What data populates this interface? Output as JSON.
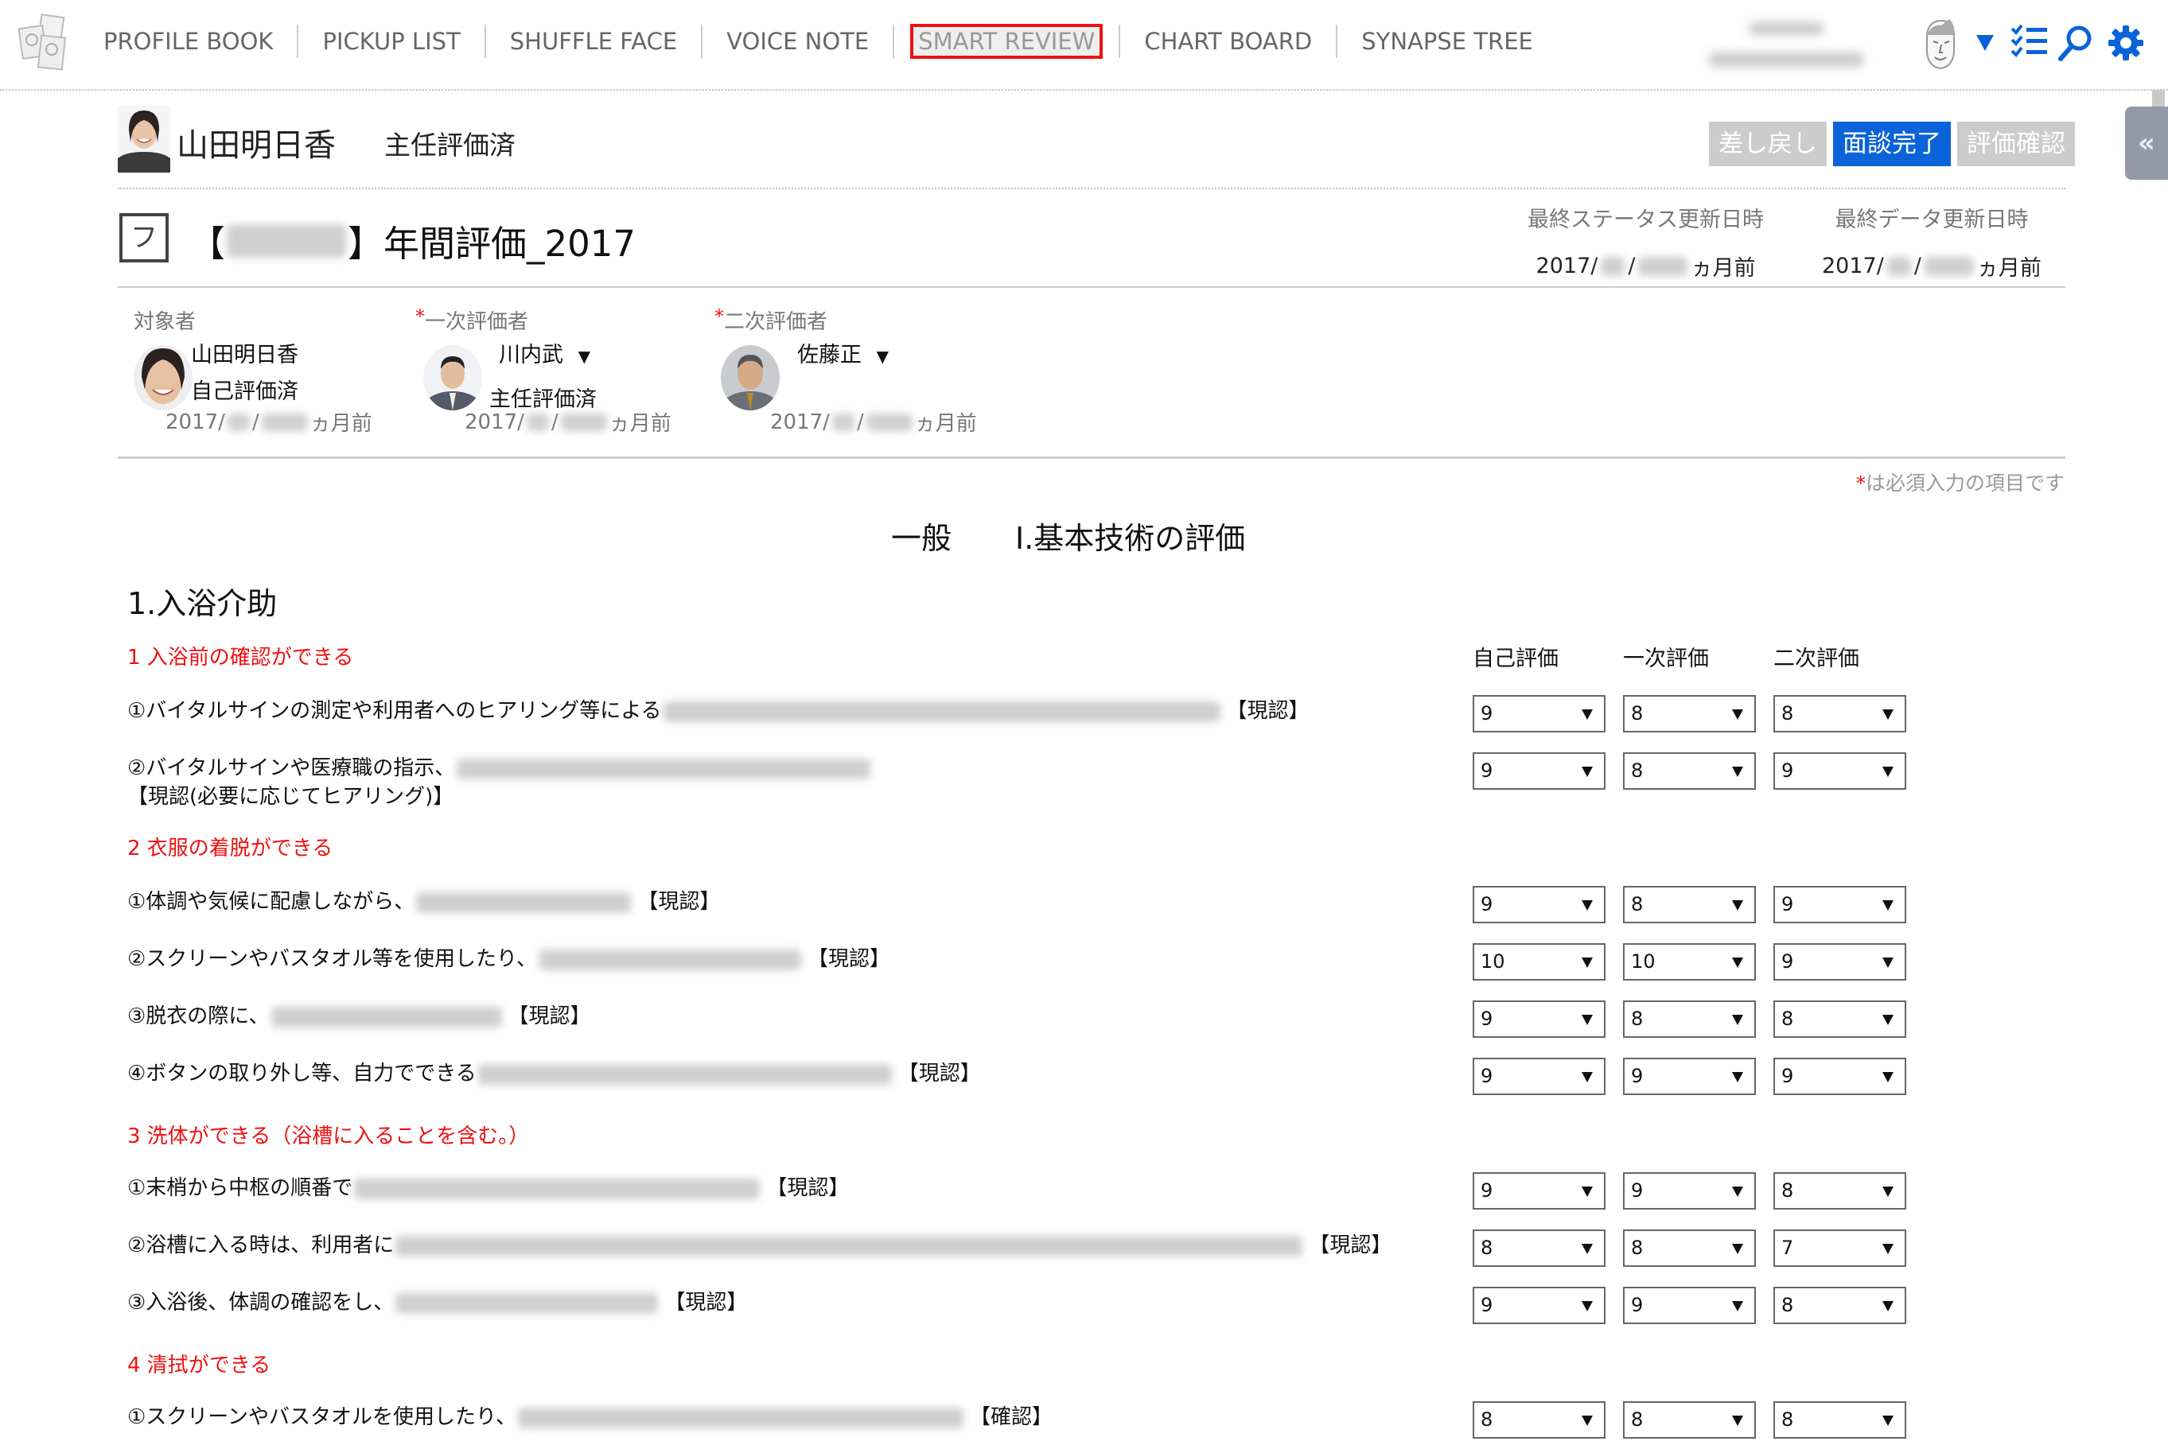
{
  "nav": {
    "items": [
      {
        "label": "PROFILE BOOK",
        "active": false
      },
      {
        "label": "PICKUP LIST",
        "active": false
      },
      {
        "label": "SHUFFLE FACE",
        "active": false
      },
      {
        "label": "VOICE NOTE",
        "active": false
      },
      {
        "label": "SMART REVIEW",
        "active": true
      },
      {
        "label": "CHART BOARD",
        "active": false
      },
      {
        "label": "SYNAPSE TREE",
        "active": false
      }
    ],
    "icons": [
      "profile-book-logo-icon",
      "user-avatar-icon",
      "checklist-icon",
      "search-icon",
      "gear-icon"
    ],
    "accent_color": "#0a63d8",
    "active_outline_color": "#ee1111"
  },
  "person": {
    "name": "山田明日香",
    "status": "主任評価済"
  },
  "status_buttons": [
    {
      "label": "差し戻し",
      "state": "disabled"
    },
    {
      "label": "面談完了",
      "state": "active"
    },
    {
      "label": "評価確認",
      "state": "disabled"
    }
  ],
  "evaluation": {
    "kind_badge": "フ",
    "title_prefix": "【",
    "title_suffix": "】年間評価_2017",
    "last_status_update_label": "最終ステータス更新日時",
    "last_status_update_year": "2017/",
    "last_status_update_relative": "ヵ月前",
    "last_data_update_label": "最終データ更新日時",
    "last_data_update_year": "2017/",
    "last_data_update_relative": "ヵ月前"
  },
  "evaluators": [
    {
      "role": "対象者",
      "required": false,
      "name": "山田明日香",
      "status": "自己評価済",
      "date_year": "2017/",
      "date_relative": "ヵ月前",
      "has_dropdown": false
    },
    {
      "role": "一次評価者",
      "required": true,
      "name": "川内武",
      "status": "主任評価済",
      "date_year": "2017/",
      "date_relative": "ヵ月前",
      "has_dropdown": true
    },
    {
      "role": "二次評価者",
      "required": true,
      "name": "佐藤正",
      "status": "",
      "date_year": "2017/",
      "date_relative": "ヵ月前",
      "has_dropdown": true
    }
  ],
  "required_mark": "*",
  "required_note": "は必須入力の項目です",
  "section": {
    "group": "一般",
    "title": "Ⅰ.基本技術の評価"
  },
  "category": "1.入浴介助",
  "columns": [
    "自己評価",
    "一次評価",
    "二次評価"
  ],
  "subsections": [
    {
      "title": "1 入浴前の確認ができる",
      "items": [
        {
          "text": "①バイタルサインの測定や利用者へのヒアリング等による",
          "tag": "【現認】",
          "tag_line2": "",
          "scores": [
            "9",
            "8",
            "8"
          ]
        },
        {
          "text": "②バイタルサインや医療職の指示、",
          "tag": "",
          "tag_line2": "【現認(必要に応じてヒアリング)】",
          "scores": [
            "9",
            "8",
            "9"
          ]
        }
      ]
    },
    {
      "title": "2 衣服の着脱ができる",
      "items": [
        {
          "text": "①体調や気候に配慮しながら、",
          "tag": "【現認】",
          "tag_line2": "",
          "scores": [
            "9",
            "8",
            "9"
          ]
        },
        {
          "text": "②スクリーンやバスタオル等を使用したり、",
          "tag": "【現認】",
          "tag_line2": "",
          "scores": [
            "10",
            "10",
            "9"
          ]
        },
        {
          "text": "③脱衣の際に、",
          "tag": "【現認】",
          "tag_line2": "",
          "scores": [
            "9",
            "8",
            "8"
          ]
        },
        {
          "text": "④ボタンの取り外し等、自力でできる",
          "tag": "【現認】",
          "tag_line2": "",
          "scores": [
            "9",
            "9",
            "9"
          ]
        }
      ]
    },
    {
      "title": "3 洗体ができる（浴槽に入ることを含む。）",
      "items": [
        {
          "text": "①末梢から中枢の順番で",
          "tag": "【現認】",
          "tag_line2": "",
          "scores": [
            "9",
            "9",
            "8"
          ]
        },
        {
          "text": "②浴槽に入る時は、利用者に",
          "tag": "【現認】",
          "tag_line2": "",
          "scores": [
            "8",
            "8",
            "7"
          ]
        },
        {
          "text": "③入浴後、体調の確認をし、",
          "tag": "【現認】",
          "tag_line2": "",
          "scores": [
            "9",
            "9",
            "8"
          ]
        }
      ]
    },
    {
      "title": "4 清拭ができる",
      "items": [
        {
          "text": "①スクリーンやバスタオルを使用したり、",
          "tag": "【確認】",
          "tag_line2": "",
          "scores": [
            "8",
            "8",
            "8"
          ]
        }
      ]
    }
  ]
}
